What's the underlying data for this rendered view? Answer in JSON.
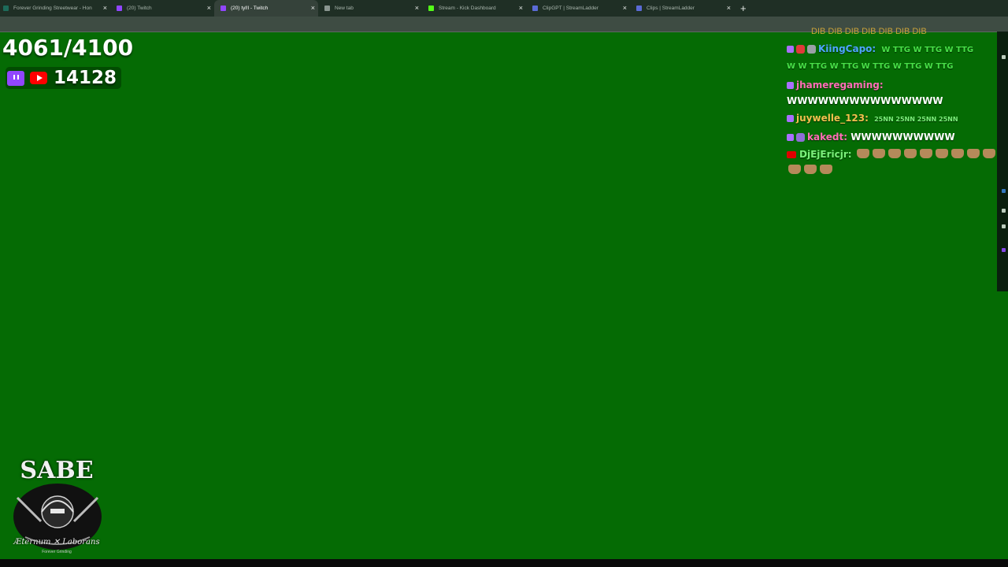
{
  "browser": {
    "tabs": [
      {
        "title": "Forever Grinding Streetwear - Hon",
        "favicon_color": "#1d6b5a",
        "active": false
      },
      {
        "title": "(20) Twitch",
        "favicon_color": "#9146ff",
        "active": false
      },
      {
        "title": "(20) tyl!l - Twitch",
        "favicon_color": "#9146ff",
        "active": true
      },
      {
        "title": "New tab",
        "favicon_color": "#8a9690",
        "active": false
      },
      {
        "title": "Stream - Kick Dashboard",
        "favicon_color": "#53fc18",
        "active": false
      },
      {
        "title": "ClipGPT | StreamLadder",
        "favicon_color": "#5b6bd6",
        "active": false
      },
      {
        "title": "Clips | StreamLadder",
        "favicon_color": "#5b6bd6",
        "active": false
      }
    ],
    "close_glyph": "×",
    "new_tab_glyph": "+"
  },
  "overlay": {
    "goal_text": "4061/4100",
    "viewer_count": "14128",
    "platform_icons": [
      "twitch-icon",
      "youtube-icon"
    ]
  },
  "chat": {
    "cutoff_text": "DIB DIB DIB DIB DIB DIB DIB",
    "messages": [
      {
        "platform": "twitch",
        "user": "KiingCapo:",
        "user_color": "#4ea6ff",
        "text": "",
        "emote_line": "W TTG W TTG W TTG",
        "emote_line_2": "W W TTG W TTG W TTG W TTG W TTG"
      },
      {
        "platform": "twitch",
        "user": "jhameregaming:",
        "user_color": "#ff6fb7",
        "text": "WWWWWWWWWWWWWWW"
      },
      {
        "platform": "twitch",
        "user": "juywelle_123:",
        "user_color": "#f2c14e",
        "text": "",
        "emote_line": "25NN 25NN 25NN 25NN"
      },
      {
        "platform": "twitch",
        "user": "kakedt:",
        "user_color": "#ff6fb7",
        "text": "WWWWWWWWWW"
      },
      {
        "platform": "youtube",
        "user": "DjEjEricjr:",
        "user_color": "#7cf07c",
        "text": "",
        "thumbs": 12
      }
    ]
  },
  "logo": {
    "brand": "SABE",
    "motto": "Æternum ✕ Laborans",
    "subtitle": "Forever Grinding"
  }
}
